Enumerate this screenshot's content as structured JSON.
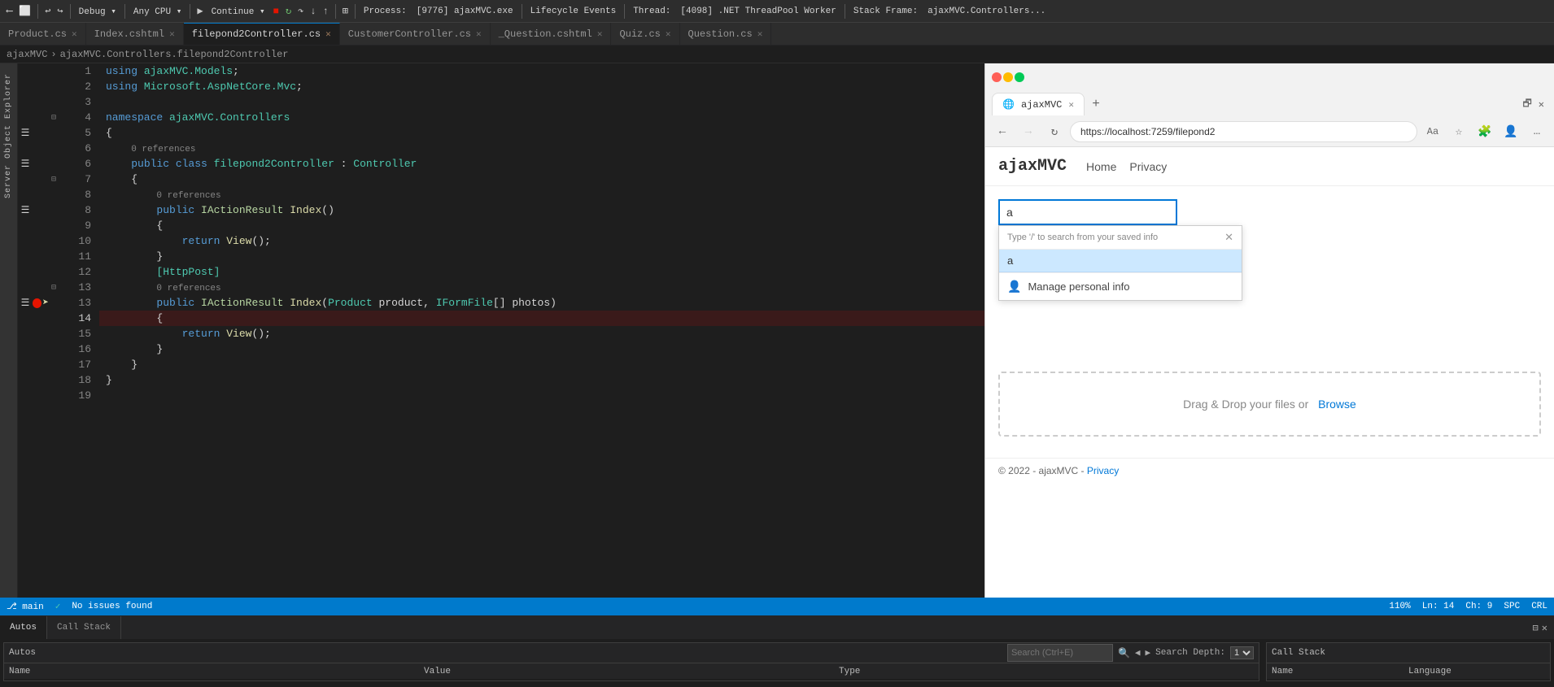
{
  "window": {
    "title": "ajaxMVC"
  },
  "vs_toolbar": {
    "process_label": "Process:",
    "process_value": "[9776] ajaxMVC.exe",
    "lifecycle_label": "Lifecycle Events",
    "thread_label": "Thread:",
    "thread_value": "[4098] .NET ThreadPool Worker",
    "stack_frame_label": "Stack Frame:",
    "stack_frame_value": "ajaxMVC.Controllers..."
  },
  "tabs": [
    {
      "label": "Product.cs",
      "active": false,
      "modified": false
    },
    {
      "label": "Index.cshtml",
      "active": false,
      "modified": false
    },
    {
      "label": "filepond2Controller.cs",
      "active": true,
      "modified": true
    },
    {
      "label": "CustomerController.cs",
      "active": false,
      "modified": false
    },
    {
      "label": "_Question.cshtml",
      "active": false,
      "modified": false
    },
    {
      "label": "Quiz.cs",
      "active": false,
      "modified": false
    },
    {
      "label": "Question.cs",
      "active": false,
      "modified": false
    }
  ],
  "breadcrumb": {
    "parts": [
      "ajaxMVC",
      "ajaxMVC.Controllers.filepond2Controller"
    ]
  },
  "sidebar": {
    "labels": [
      "Server Object Explorer"
    ]
  },
  "code": {
    "lines": [
      {
        "num": 1,
        "tokens": [
          {
            "t": "using ",
            "c": "kw"
          },
          {
            "t": "ajaxMVC.Models",
            "c": "cls"
          },
          {
            "t": ";",
            "c": "punct"
          }
        ]
      },
      {
        "num": 2,
        "tokens": [
          {
            "t": "using ",
            "c": "kw"
          },
          {
            "t": "Microsoft.AspNetCore.Mvc",
            "c": "cls"
          },
          {
            "t": ";",
            "c": "punct"
          }
        ]
      },
      {
        "num": 3,
        "tokens": []
      },
      {
        "num": 4,
        "tokens": [
          {
            "t": "namespace ",
            "c": "kw"
          },
          {
            "t": "ajaxMVC.Controllers",
            "c": "cls"
          }
        ]
      },
      {
        "num": 5,
        "tokens": [
          {
            "t": "{",
            "c": "punct"
          }
        ]
      },
      {
        "num": 6,
        "tokens": [
          {
            "t": "    ",
            "c": ""
          },
          {
            "t": "0 references",
            "c": "ref"
          },
          {
            "t": "",
            "c": ""
          }
        ]
      },
      {
        "num": 6,
        "tokens": [
          {
            "t": "    ",
            "c": ""
          },
          {
            "t": "public ",
            "c": "kw"
          },
          {
            "t": "class ",
            "c": "kw"
          },
          {
            "t": "filepond2Controller",
            "c": "cls"
          },
          {
            "t": " : ",
            "c": "punct"
          },
          {
            "t": "Controller",
            "c": "cls"
          }
        ]
      },
      {
        "num": 7,
        "tokens": [
          {
            "t": "    {",
            "c": "punct"
          }
        ]
      },
      {
        "num": 8,
        "tokens": [
          {
            "t": "        ",
            "c": ""
          },
          {
            "t": "0 references",
            "c": "ref"
          }
        ]
      },
      {
        "num": 8,
        "tokens": [
          {
            "t": "        ",
            "c": ""
          },
          {
            "t": "public ",
            "c": "kw"
          },
          {
            "t": "IActionResult ",
            "c": "iface"
          },
          {
            "t": "Index",
            "c": "fn"
          },
          {
            "t": "()",
            "c": "punct"
          }
        ]
      },
      {
        "num": 9,
        "tokens": [
          {
            "t": "        {",
            "c": "punct"
          }
        ]
      },
      {
        "num": 10,
        "tokens": [
          {
            "t": "            ",
            "c": ""
          },
          {
            "t": "return ",
            "c": "kw"
          },
          {
            "t": "View",
            "c": "fn"
          },
          {
            "t": "();",
            "c": "punct"
          }
        ]
      },
      {
        "num": 11,
        "tokens": [
          {
            "t": "        }",
            "c": "punct"
          }
        ]
      },
      {
        "num": 12,
        "tokens": [
          {
            "t": "        ",
            "c": ""
          },
          {
            "t": "[HttpPost]",
            "c": "cls"
          }
        ]
      },
      {
        "num": 13,
        "tokens": [
          {
            "t": "        ",
            "c": ""
          },
          {
            "t": "0 references",
            "c": "ref"
          }
        ]
      },
      {
        "num": 13,
        "tokens": [
          {
            "t": "        ",
            "c": ""
          },
          {
            "t": "public ",
            "c": "kw"
          },
          {
            "t": "IActionResult ",
            "c": "iface"
          },
          {
            "t": "Index",
            "c": "fn"
          },
          {
            "t": "(",
            "c": "punct"
          },
          {
            "t": "Product",
            "c": "cls"
          },
          {
            "t": " product, ",
            "c": ""
          },
          {
            "t": "IFormFile",
            "c": "cls"
          },
          {
            "t": "[] photos)",
            "c": "punct"
          }
        ]
      },
      {
        "num": 14,
        "tokens": [
          {
            "t": "        {",
            "c": "punct"
          }
        ]
      },
      {
        "num": 15,
        "tokens": [
          {
            "t": "            ",
            "c": ""
          },
          {
            "t": "return ",
            "c": "kw"
          },
          {
            "t": "View",
            "c": "fn"
          },
          {
            "t": "();",
            "c": "punct"
          }
        ]
      },
      {
        "num": 16,
        "tokens": [
          {
            "t": "        }",
            "c": "punct"
          }
        ]
      },
      {
        "num": 17,
        "tokens": [
          {
            "t": "    }",
            "c": "punct"
          }
        ]
      },
      {
        "num": 18,
        "tokens": [
          {
            "t": "}",
            "c": "punct"
          }
        ]
      },
      {
        "num": 19,
        "tokens": []
      }
    ]
  },
  "browser": {
    "url": "https://localhost:7259/filepond2",
    "tab_title": "ajaxMVC",
    "brand": "ajaxMVC",
    "nav_links": [
      "Home",
      "Privacy"
    ],
    "search_input_value": "a",
    "search_input_placeholder": "",
    "autocomplete_hint": "Type '/' to search from your saved info",
    "autocomplete_item_value": "a",
    "manage_personal_info": "Manage personal info",
    "drag_drop_text": "Drag & Drop your files or",
    "drag_drop_link": "Browse",
    "footer_text": "© 2022 - ajaxMVC -",
    "footer_link": "Privacy"
  },
  "bottom": {
    "panel_tabs": [
      "Autos",
      "Call Stack"
    ],
    "active_tab": "Autos",
    "search_placeholder": "Search (Ctrl+E)",
    "search_depth_label": "Search Depth:",
    "table_headers": [
      "Name",
      "Value",
      "Type"
    ],
    "call_stack_headers": [
      "Name",
      "Language"
    ],
    "zoom": "110%",
    "status_no_issues": "No issues found",
    "ln": "Ln: 14",
    "ch": "Ch: 9",
    "spc": "SPC",
    "crl": "CRL"
  }
}
